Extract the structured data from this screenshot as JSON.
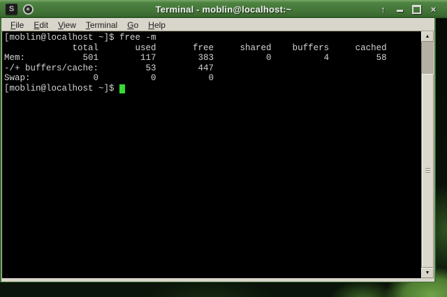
{
  "titlebar": {
    "title": "Terminal - moblin@localhost:~",
    "tray_logo_glyph": "S",
    "controls": {
      "shade_glyph": "↑",
      "close_glyph": "×"
    }
  },
  "menubar": {
    "items": [
      {
        "mnemonic": "F",
        "rest": "ile"
      },
      {
        "mnemonic": "E",
        "rest": "dit"
      },
      {
        "mnemonic": "V",
        "rest": "iew"
      },
      {
        "mnemonic": "T",
        "rest": "erminal"
      },
      {
        "mnemonic": "G",
        "rest": "o"
      },
      {
        "mnemonic": "H",
        "rest": "elp"
      }
    ]
  },
  "terminal": {
    "lines": [
      "[moblin@localhost ~]$ free -m",
      "             total       used       free     shared    buffers     cached",
      "Mem:           501        117        383          0          4         58",
      "-/+ buffers/cache:         53        447",
      "Swap:            0          0          0"
    ],
    "prompt": "[moblin@localhost ~]$ ",
    "free_output": {
      "headers": [
        "total",
        "used",
        "free",
        "shared",
        "buffers",
        "cached"
      ],
      "rows": [
        {
          "label": "Mem:",
          "values": [
            501,
            117,
            383,
            0,
            4,
            58
          ]
        },
        {
          "label": "-/+ buffers/cache:",
          "values": [
            53,
            447
          ]
        },
        {
          "label": "Swap:",
          "values": [
            0,
            0,
            0
          ]
        }
      ]
    }
  },
  "scrollbar": {
    "up_glyph": "▲",
    "down_glyph": "▼"
  },
  "colors": {
    "titlebar_green": "#447639",
    "window_border_green": "#3d7032",
    "terminal_bg": "#000000",
    "terminal_fg": "#d4d4d2",
    "cursor_green": "#33dd33",
    "menubar_bg": "#d8d5cb"
  }
}
